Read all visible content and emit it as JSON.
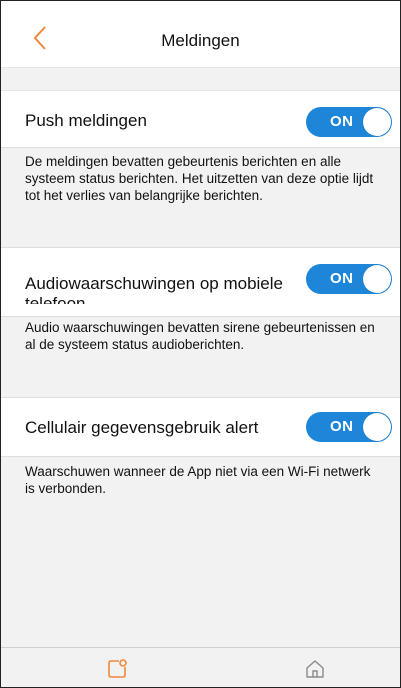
{
  "header": {
    "title": "Meldingen",
    "back_icon": "chevron-left-icon",
    "accent_color": "#f0883a"
  },
  "settings": [
    {
      "label": "Push meldingen",
      "toggle": "ON",
      "description": "De meldingen bevatten gebeurtenis berichten en alle systeem status berichten. Het uitzetten van deze optie lijdt tot het verlies van belangrijke berichten."
    },
    {
      "label": "Audiowaarschuwingen op mobiele telefoon",
      "toggle": "ON",
      "description": "Audio waarschuwingen bevatten sirene gebeurtenissen en al de systeem status audioberichten."
    },
    {
      "label": "Cellulair gegevensgebruik alert",
      "toggle": "ON",
      "description": "Waarschuwen wanneer de App niet via een Wi-Fi netwerk is verbonden."
    }
  ],
  "toggle_color": "#1d86d9",
  "bottom_nav": {
    "left_icon": "notification-icon",
    "right_icon": "home-icon"
  }
}
